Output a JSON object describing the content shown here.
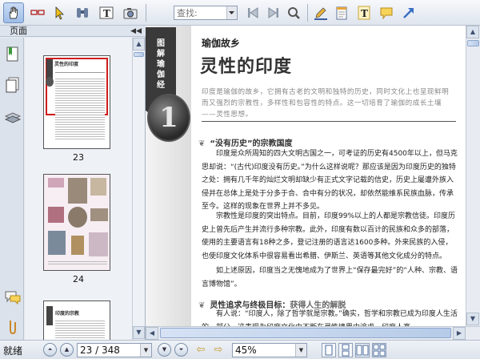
{
  "toolbar": {
    "search_placeholder": "查找:",
    "accent": "#3a6fc4"
  },
  "sidebar": {
    "panel_title": "页面",
    "collapse_glyph": "◀◀",
    "thumbnails": [
      {
        "page_label": "23",
        "mini_title": "灵性的印度"
      },
      {
        "page_label": "24"
      },
      {
        "page_label": "",
        "mini_title": "印度的宗教"
      }
    ]
  },
  "document": {
    "book_title": "图解瑜伽经",
    "chapter_number": "1",
    "series": "瑜伽故乡",
    "chapter_title": "灵性的印度",
    "intro": "印度是瑜伽的故乡，它拥有古老的文明和独特的历史，同时文化上也呈现鲜明而又强烈的宗教性，多样性和包容性的特点。这一切培育了瑜伽的成长土壤——灵性思想。",
    "section1_title": "“没有历史”的宗教国度",
    "para1": "印度是众所周知的四大文明古国之一，可考证的历史有4500年以上，但马克思却说：“(古代)印度没有历史。”为什么这样说呢？那应该是因为印度历史的独特之处：拥有几千年的灿烂文明却缺少有正式文字记载的信史，历史上屡遭外族入侵并在总体上是处于分多于合、合中有分的状况，却依然能维系民族血脉，传承至今。这样的现象在世界上并不多见。",
    "para2": "宗教性是印度的突出特点。目前，印度99%以上的人都是宗教信徒。印度历史上曾先后产生并流行多种宗教。此外，印度有数以百计的民族和众多的部落，使用的主要语言有18种之多，登记注册的语言达1600多种。外来民族的入侵，也使印度文化体系中很容易看出希腊、伊斯兰、英语等其他文化成分的特点。",
    "para3": "如上述原因，印度当之无愧地成为了世界上“保存最完好”的“人种、宗教、语言博物馆”。",
    "section2_title": "灵性追求与终极目标：",
    "section2_sub": "获得人生的解脱",
    "para4": "有人说：“印度人，除了哲学就是宗教。”确实，哲学和宗教已成为印度人生活的一部分。这表现为印度文化中不断在灵性境界中追求，印度人高"
  },
  "statusbar": {
    "status": "就绪",
    "page_indicator": "23 / 348",
    "zoom": "45%"
  }
}
